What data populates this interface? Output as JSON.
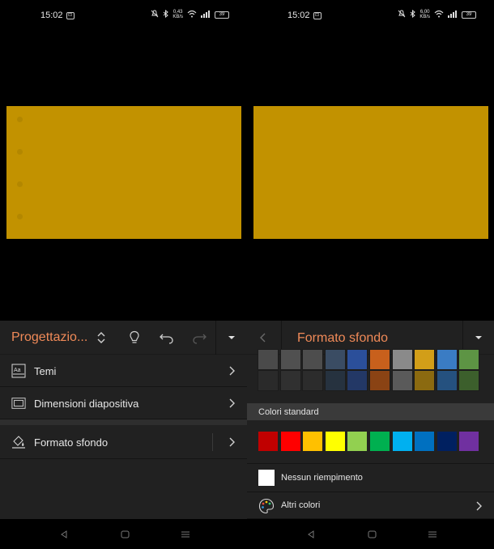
{
  "left": {
    "status": {
      "time": "15:02",
      "net_speed": "0,43\nKB/s",
      "battery": "39"
    },
    "toolbar": {
      "title": "Progettazio..."
    },
    "menu": [
      {
        "label": "Temi",
        "icon": "themes-icon"
      },
      {
        "label": "Dimensioni diapositiva",
        "icon": "slide-size-icon"
      },
      {
        "label": "Formato sfondo",
        "icon": "format-background-icon"
      }
    ]
  },
  "right": {
    "status": {
      "time": "15:02",
      "net_speed": "6,00\nKB/s",
      "battery": "39"
    },
    "toolbar": {
      "title": "Formato sfondo"
    },
    "theme_colors_row1": [
      "#4a4a4a",
      "#505050",
      "#4d4d4d",
      "#3a4c63",
      "#2b4f9a",
      "#c8601c",
      "#8a8a8a",
      "#d29e18",
      "#3a7cc4",
      "#5d9444"
    ],
    "theme_colors_row2": [
      "#2a2a2a",
      "#303030",
      "#2c2c2c",
      "#26323f",
      "#233866",
      "#8a4314",
      "#5a5a5a",
      "#8b6a10",
      "#25517f",
      "#3c5f2c"
    ],
    "standard_header": "Colori standard",
    "standard_colors": [
      "#c00000",
      "#ff0000",
      "#ffc000",
      "#ffff00",
      "#92d050",
      "#00b050",
      "#00b0f0",
      "#0070c0",
      "#002060",
      "#7030a0"
    ],
    "no_fill_label": "Nessun riempimento",
    "more_colors_label": "Altri colori"
  },
  "colors": {
    "accent": "#f08a58",
    "slide": "#c29200",
    "panel": "#212121"
  }
}
